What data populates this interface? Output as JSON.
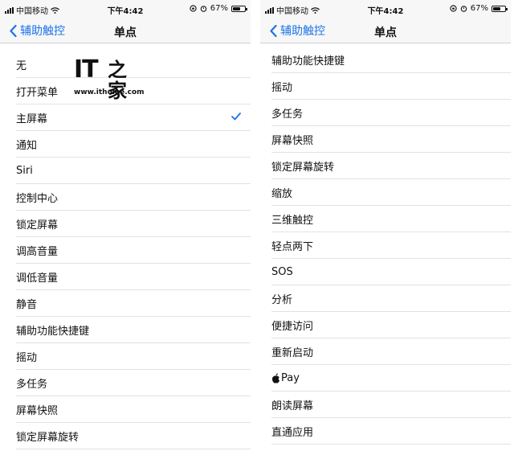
{
  "status_bar": {
    "carrier": "中国移动",
    "time": "下午4:42",
    "battery": "67%",
    "battery_level": 0.67
  },
  "nav": {
    "back_label": "辅助触控",
    "title": "单点"
  },
  "left_list": [
    {
      "label": "无",
      "selected": false
    },
    {
      "label": "打开菜单",
      "selected": false
    },
    {
      "label": "主屏幕",
      "selected": true
    },
    {
      "label": "通知",
      "selected": false
    },
    {
      "label": "Siri",
      "selected": false
    },
    {
      "label": "控制中心",
      "selected": false
    },
    {
      "label": "锁定屏幕",
      "selected": false
    },
    {
      "label": "调高音量",
      "selected": false
    },
    {
      "label": "调低音量",
      "selected": false
    },
    {
      "label": "静音",
      "selected": false
    },
    {
      "label": "辅助功能快捷键",
      "selected": false
    },
    {
      "label": "摇动",
      "selected": false
    },
    {
      "label": "多任务",
      "selected": false
    },
    {
      "label": "屏幕快照",
      "selected": false
    },
    {
      "label": "锁定屏幕旋转",
      "selected": false
    }
  ],
  "right_list": [
    {
      "label": "辅助功能快捷键"
    },
    {
      "label": "摇动"
    },
    {
      "label": "多任务"
    },
    {
      "label": "屏幕快照"
    },
    {
      "label": "锁定屏幕旋转"
    },
    {
      "label": "缩放"
    },
    {
      "label": "三维触控"
    },
    {
      "label": "轻点两下"
    },
    {
      "label": "SOS"
    },
    {
      "label": "分析"
    },
    {
      "label": "便捷访问"
    },
    {
      "label": "重新启动"
    },
    {
      "label": "Pay",
      "icon": "apple-logo-icon"
    },
    {
      "label": "朗读屏幕"
    },
    {
      "label": "直通应用"
    }
  ],
  "watermark": {
    "brand": "IT",
    "brand_cn": "之家",
    "url": "www.ithome.com"
  },
  "colors": {
    "accent": "#1a73e8",
    "bar_background": "#f7f7f7",
    "separator": "#e2e2e6"
  }
}
